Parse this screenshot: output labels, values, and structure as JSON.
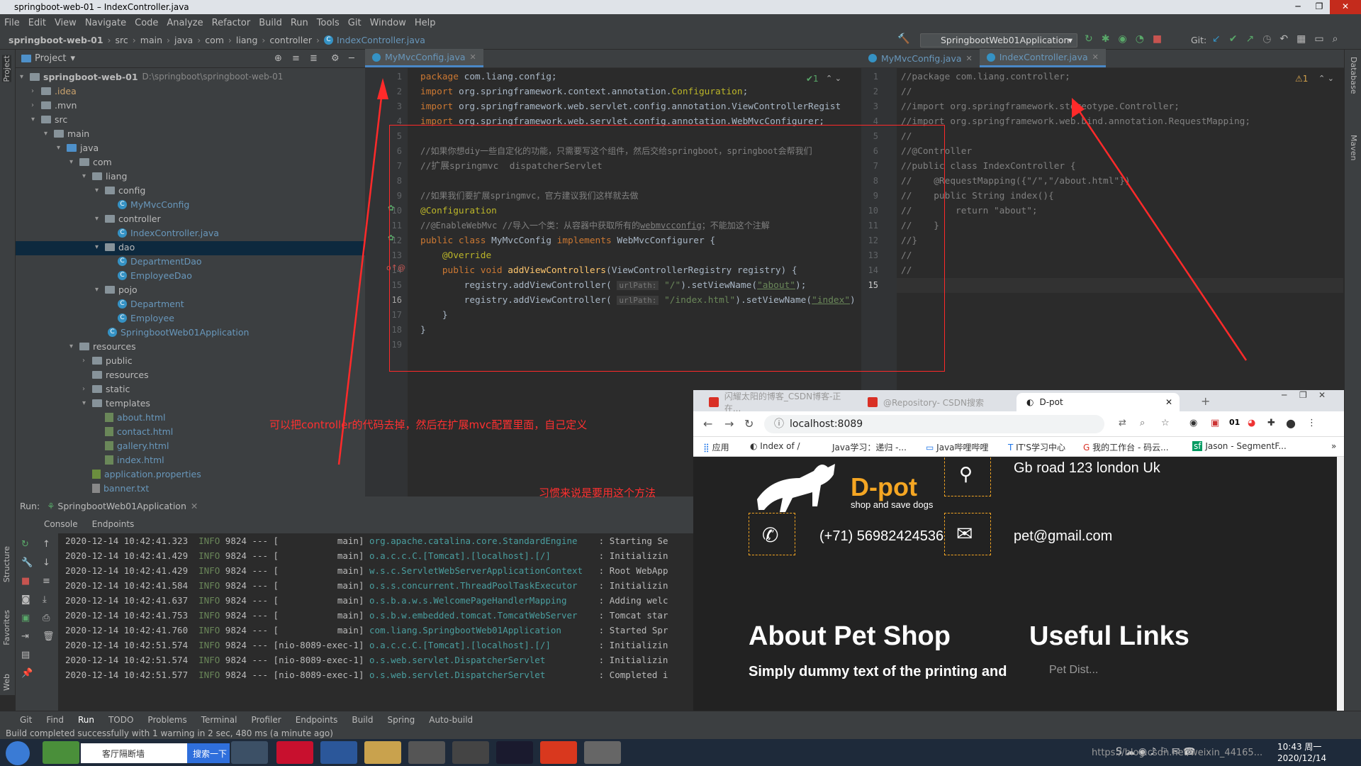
{
  "window": {
    "title": "springboot-web-01 – IndexController.java"
  },
  "menu": [
    "File",
    "Edit",
    "View",
    "Navigate",
    "Code",
    "Analyze",
    "Refactor",
    "Build",
    "Run",
    "Tools",
    "Git",
    "Window",
    "Help"
  ],
  "breadcrumb": [
    "springboot-web-01",
    "src",
    "main",
    "java",
    "com",
    "liang",
    "controller",
    "IndexController.java"
  ],
  "run_config": "SpringbootWeb01Application",
  "git_label": "Git:",
  "project_panel": {
    "title": "Project",
    "root": "springboot-web-01",
    "root_path": "D:\\springboot\\springboot-web-01",
    "items": [
      ".idea",
      ".mvn",
      "src",
      "main",
      "java",
      "com",
      "liang",
      "config",
      "MyMvcConfig",
      "controller",
      "IndexController.java",
      "dao",
      "DepartmentDao",
      "EmployeeDao",
      "pojo",
      "Department",
      "Employee",
      "SpringbootWeb01Application",
      "resources",
      "public",
      "resources",
      "static",
      "templates",
      "about.html",
      "contact.html",
      "gallery.html",
      "index.html",
      "application.properties",
      "banner.txt"
    ]
  },
  "editor_left": {
    "tab": "MyMvcConfig.java",
    "inspection": "✔1",
    "line_numbers": [
      "1",
      "2",
      "3",
      "4",
      "5",
      "6",
      "7",
      "8",
      "9",
      "10",
      "11",
      "12",
      "13",
      "14",
      "15",
      "16",
      "17",
      "18",
      "19"
    ],
    "lines": [
      [
        "package com.liang.config;"
      ],
      [
        "import org.springframework.context.annotation.Configuration;"
      ],
      [
        "import org.springframework.web.servlet.config.annotation.ViewControllerRegist"
      ],
      [
        "import org.springframework.web.servlet.config.annotation.WebMvcConfigurer;"
      ],
      [
        ""
      ],
      [
        "//如果你想diy一些自定化的功能，只需要写这个组件，然后交给springboot，springboot会帮我们"
      ],
      [
        "//扩展springmvc  dispatcherServlet"
      ],
      [
        ""
      ],
      [
        "//如果我们要扩展springmvc，官方建议我们这样就去做"
      ],
      [
        "@Configuration"
      ],
      [
        "//@EnableWebMvc //导入一个类：从容器中获取所有的webmvcconfig；不能加这个注解"
      ],
      [
        "public class MyMvcConfig implements WebMvcConfigurer {"
      ],
      [
        "    @Override"
      ],
      [
        "    public void addViewControllers(ViewControllerRegistry registry) {"
      ],
      [
        "        registry.addViewController( urlPath: \"/\").setViewName(\"about\");"
      ],
      [
        "        registry.addViewController( urlPath: \"/index.html\").setViewName(\"index\")"
      ],
      [
        "    }"
      ],
      [
        "}"
      ],
      [
        ""
      ]
    ]
  },
  "editor_right": {
    "tabs": [
      "MyMvcConfig.java",
      "IndexController.java"
    ],
    "inspection": "⚠1",
    "line_numbers": [
      "1",
      "2",
      "3",
      "4",
      "5",
      "6",
      "7",
      "8",
      "9",
      "10",
      "11",
      "12",
      "13",
      "14",
      "15"
    ],
    "lines": [
      "//package com.liang.controller;",
      "//",
      "//import org.springframework.stereotype.Controller;",
      "//import org.springframework.web.bind.annotation.RequestMapping;",
      "//",
      "//@Controller",
      "//public class IndexController {",
      "//    @RequestMapping({\"/\",\"/about.html\"})",
      "//    public String index(){",
      "//        return \"about\";",
      "//    }",
      "//}",
      "//",
      "//",
      ""
    ]
  },
  "annotations": {
    "note1": "可以把controller的代码去掉，然后在扩展mvc配置里面，自己定义",
    "note2": "习惯来说是要用这个方法"
  },
  "run_panel": {
    "label": "Run:",
    "config": "SpringbootWeb01Application",
    "tabs": [
      "Console",
      "Endpoints"
    ],
    "logs": [
      {
        "ts": "2020-12-14 10:42:41.323",
        "lvl": "INFO",
        "pid": "9824",
        "sep": "--- [",
        "thread": "           main]",
        "logger": "org.apache.catalina.core.StandardEngine   ",
        "msg": ": Starting Se"
      },
      {
        "ts": "2020-12-14 10:42:41.429",
        "lvl": "INFO",
        "pid": "9824",
        "sep": "--- [",
        "thread": "           main]",
        "logger": "o.a.c.c.C.[Tomcat].[localhost].[/]        ",
        "msg": ": Initializin"
      },
      {
        "ts": "2020-12-14 10:42:41.429",
        "lvl": "INFO",
        "pid": "9824",
        "sep": "--- [",
        "thread": "           main]",
        "logger": "w.s.c.ServletWebServerApplicationContext  ",
        "msg": ": Root WebApp"
      },
      {
        "ts": "2020-12-14 10:42:41.584",
        "lvl": "INFO",
        "pid": "9824",
        "sep": "--- [",
        "thread": "           main]",
        "logger": "o.s.s.concurrent.ThreadPoolTaskExecutor   ",
        "msg": ": Initializin"
      },
      {
        "ts": "2020-12-14 10:42:41.637",
        "lvl": "INFO",
        "pid": "9824",
        "sep": "--- [",
        "thread": "           main]",
        "logger": "o.s.b.a.w.s.WelcomePageHandlerMapping     ",
        "msg": ": Adding welc"
      },
      {
        "ts": "2020-12-14 10:42:41.753",
        "lvl": "INFO",
        "pid": "9824",
        "sep": "--- [",
        "thread": "           main]",
        "logger": "o.s.b.w.embedded.tomcat.TomcatWebServer   ",
        "msg": ": Tomcat star"
      },
      {
        "ts": "2020-12-14 10:42:41.760",
        "lvl": "INFO",
        "pid": "9824",
        "sep": "--- [",
        "thread": "           main]",
        "logger": "com.liang.SpringbootWeb01Application      ",
        "msg": ": Started Spr"
      },
      {
        "ts": "2020-12-14 10:42:51.574",
        "lvl": "INFO",
        "pid": "9824",
        "sep": "---",
        "thread": " [nio-8089-exec-1]",
        "logger": "o.a.c.c.C.[Tomcat].[localhost].[/]        ",
        "msg": ": Initializin"
      },
      {
        "ts": "2020-12-14 10:42:51.574",
        "lvl": "INFO",
        "pid": "9824",
        "sep": "---",
        "thread": " [nio-8089-exec-1]",
        "logger": "o.s.web.servlet.DispatcherServlet         ",
        "msg": ": Initializin"
      },
      {
        "ts": "2020-12-14 10:42:51.577",
        "lvl": "INFO",
        "pid": "9824",
        "sep": "---",
        "thread": " [nio-8089-exec-1]",
        "logger": "o.s.web.servlet.DispatcherServlet         ",
        "msg": ": Completed i"
      }
    ]
  },
  "bottom_tools": [
    "Git",
    "Find",
    "Run",
    "TODO",
    "Problems",
    "Terminal",
    "Profiler",
    "Endpoints",
    "Build",
    "Spring",
    "Auto-build"
  ],
  "status": "Build completed successfully with 1 warning in 2 sec, 480 ms (a minute ago)",
  "left_strip": [
    "Project",
    "Structure",
    "Favorites",
    "Web"
  ],
  "right_strip": [
    "Database",
    "Maven"
  ],
  "browser": {
    "tabs": [
      "闪耀太阳的博客_CSDN博客-正在...",
      "@Repository- CSDN搜索",
      "D-pot"
    ],
    "url": "localhost:8089",
    "bookmarks": [
      "应用",
      "Index of /",
      "Java学习：递归 -...",
      "Java哔哩哔哩",
      "IT'S学习中心",
      "我的工作台 - 码云...",
      "Jason - SegmentF..."
    ],
    "logo_title": "D-pot",
    "logo_sub": "shop and save dogs",
    "address": "Gb road 123 london Uk",
    "phone": "(+71) 56982424536",
    "email": "pet@gmail.com",
    "h_about": "About Pet Shop",
    "h_links": "Useful Links",
    "about_text": "Simply dummy text of the printing and",
    "links_partial": "Pet Dist..."
  },
  "taskbar": {
    "search": "客厅隔断墙",
    "search_btn": "搜索一下",
    "clock": "10:43 周一",
    "date": "2020/12/14",
    "watermark": "https://blog.csdn.net/weixin_44165..."
  },
  "colors": {
    "accent": "#4a88c7",
    "annotation": "#ff2a2a",
    "brand_orange": "#f5a623"
  }
}
